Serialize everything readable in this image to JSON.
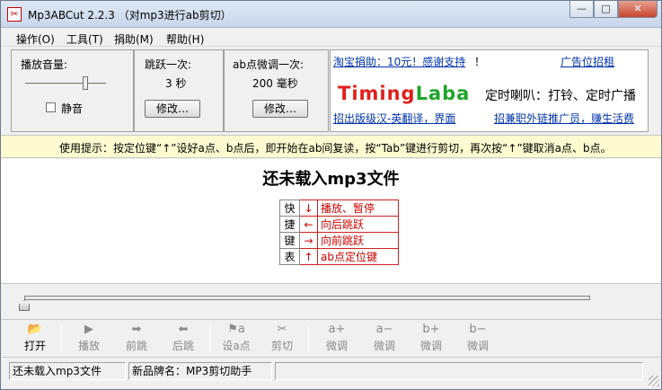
{
  "window": {
    "title": "Mp3ABCut 2.2.3 （对mp3进行ab剪切）",
    "icon": "scissors-icon",
    "minimize": "—",
    "maximize": "□",
    "close": "✕"
  },
  "menu": [
    {
      "label": "操作(O)"
    },
    {
      "label": "工具(T)"
    },
    {
      "label": "捐助(M)"
    },
    {
      "label": "帮助(H)"
    }
  ],
  "volume": {
    "label": "播放音量:",
    "level": 0.82,
    "mute_label": "静音",
    "mute_checked": false
  },
  "jump": {
    "label": "跳跃一次:",
    "value": "3 秒",
    "button": "修改…"
  },
  "fine": {
    "label": "ab点微调一次:",
    "value": "200 毫秒",
    "button": "修改…"
  },
  "ad": {
    "donate_link": "淘宝捐助：10元！感谢支持",
    "donate_suffix": "！",
    "ad_link": "广告位招租",
    "logo_red": "Timing",
    "logo_green": "Laba",
    "slogan": "定时喇叭：打铃、定时广播",
    "translate_link": "招出版级汉-英翻译，界面",
    "recruit_link": "招兼职外链推广员，赚生活费"
  },
  "tip": "使用提示：按定位键“↑”设好a点、b点后，即开始在ab间复读，按“Tab”键进行剪切，再次按“↑”键取消a点、b点。",
  "main": {
    "heading": "还未载入mp3文件",
    "shortcuts_chars": [
      "快",
      "捷",
      "键",
      "表"
    ],
    "shortcuts": [
      {
        "arrow": "↓",
        "desc": "播放、暂停"
      },
      {
        "arrow": "←",
        "desc": "向后跳跃"
      },
      {
        "arrow": "→",
        "desc": "向前跳跃"
      },
      {
        "arrow": "↑",
        "desc": "ab点定位键"
      }
    ]
  },
  "progress": {
    "position": 0.0
  },
  "toolbar": [
    {
      "label": "打开",
      "icon": "folder-open-icon",
      "glyph": "📂",
      "enabled": true
    },
    {
      "label": "播放",
      "icon": "play-icon",
      "glyph": "▶",
      "enabled": false
    },
    {
      "label": "前跳",
      "icon": "jump-forward-icon",
      "glyph": "➡",
      "enabled": false
    },
    {
      "label": "后跳",
      "icon": "jump-back-icon",
      "glyph": "⬅",
      "enabled": false
    },
    {
      "label": "设a点",
      "icon": "set-a-point-icon",
      "glyph": "⚑a",
      "enabled": false
    },
    {
      "label": "剪切",
      "icon": "scissors-icon",
      "glyph": "✂",
      "enabled": false
    },
    {
      "label": "微调",
      "icon": "a-plus-icon",
      "glyph": "a+",
      "enabled": false
    },
    {
      "label": "微调",
      "icon": "a-minus-icon",
      "glyph": "a−",
      "enabled": false
    },
    {
      "label": "微调",
      "icon": "b-plus-icon",
      "glyph": "b+",
      "enabled": false
    },
    {
      "label": "微调",
      "icon": "b-minus-icon",
      "glyph": "b−",
      "enabled": false
    }
  ],
  "status": {
    "file": "还未载入mp3文件",
    "brand": "新品牌名：MP3剪切助手",
    "extra": ""
  }
}
